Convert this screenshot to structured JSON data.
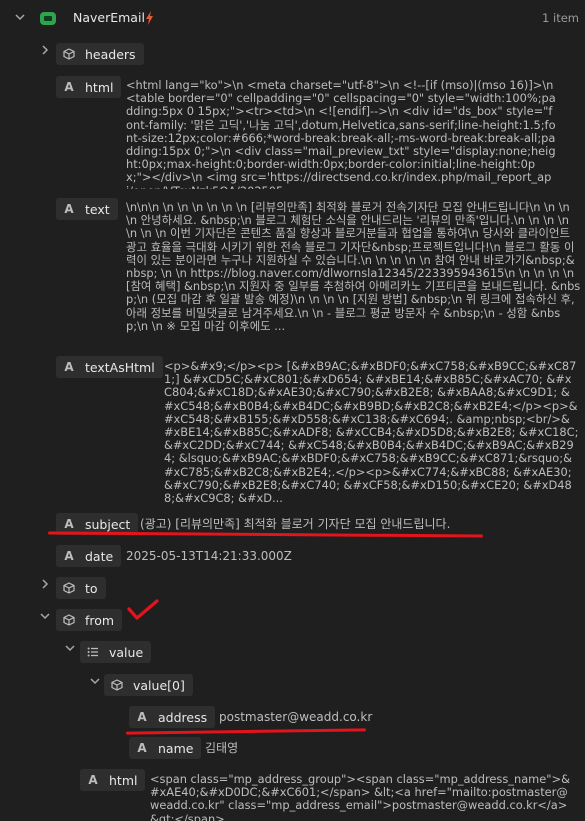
{
  "root": {
    "label": "NaverEmail",
    "count": "1 item",
    "accent": "#e05a3a"
  },
  "items": {
    "headers": "headers",
    "html": {
      "key": "html",
      "value": "<html lang=\"ko\">\\n <meta charset=\"utf-8\">\\n <!--[if (mso)|(mso 16)]>\\n <table border=\"0\" cellpadding=\"0\" cellspacing=\"0\" style=\"width:100%;padding:5px 0 15px;\"><tr><td>\\n <![endif]-->\\n <div id=\"ds_box\" style=\"font-family: '맑은 고딕','나눔 고딕',dotum,Helvetica,sans-serif;line-height:1.5;font-size:12px;color:#666;*word-break:break-all;-ms-word-break:break-all;padding:15px 0;\">\\n <div class=\"mail_preview_txt\" style=\"display:none;height:0px;max-height:0;border-width:0px;border-color:initial;line-height:0px;\"></div>\\n <img src='https://directsend.co.kr/index.php/mail_report_api/open/VTcxNzk5OA/202505..."
    },
    "text": {
      "key": "text",
      "value": "\\n\\n\\n \\n \\n \\n \\n \\n \\n [리뷰의만족] 최적화 블로거 전속기자단 모집 안내드립니다\\n \\n \\n \\n 안녕하세요. &nbsp;\\n 블로그 체험단 소식을 안내드리는 '리뷰의 만족'입니다.\\n \\n \\n \\n \\n \\n \\n 이번 기자단은 콘텐츠 품질 향상과 블로거분들과 협업을 통하여\\n 당사와 클라이언트 광고 효율을 극대화 시키기 위한 전속 블로그 기자단&nbsp;프로젝트입니다!\\n 블로그 활동 이력이 있는 분이라면 누구나 지원하실 수 있습니다.\\n \\n \\n \\n \\n 참여 안내 바로가기&nbsp;&nbsp; \\n \\n https://blog.naver.com/dlwornsla12345/223395943615\\n \\n \\n \\n \\n [참여 혜택] &nbsp;\\n 지원자 중 일부를 추첨하여 아메리카노 기프티콘을 보내드립니다. &nbsp;\\n (모집 마감 후 일괄 발송 예정)\\n \\n \\n \\n [지원 방법] &nbsp;\\n 위 링크에 접속하신 후, 아래 정보를 비밀댓글로 남겨주세요.\\n \\n - 블로그 평균 방문자 수 &nbsp;\\n - 성함 &nbsp;\\n \\n ※ 모집 마감 이후에도 ..."
    },
    "textAsHtml": {
      "key": "textAsHtml",
      "value": "<p>&#x9;</p><p> [&#xB9AC;&#xBDF0;&#xC758;&#xB9CC;&#xC871;] &#xCD5C;&#xC801;&#xD654; &#xBE14;&#xB85C;&#xAC70; &#xC804;&#xC18D;&#xAE30;&#xC790;&#xB2E8; &#xBAA8;&#xC9D1; &#xC548;&#xB0B4;&#xB4DC;&#xB9BD;&#xB2C8;&#xB2E4;</p><p>&#xC548;&#xB155;&#xD558;&#xC138;&#xC694;. &amp;nbsp;<br/>&#xBE14;&#xB85C;&#xADF8; &#xCCB4;&#xD5D8;&#xB2E8; &#xC18C;&#xC2DD;&#xC744; &#xC548;&#xB0B4;&#xB4DC;&#xB9AC;&#xB294; &lsquo;&#xB9AC;&#xBDF0;&#xC758;&#xB9CC;&#xC871;&rsquo;&#xC785;&#xB2C8;&#xB2E4;.</p><p>&#xC774;&#xBC88; &#xAE30;&#xC790;&#xB2E8;&#xC740; &#xCF58;&#xD150;&#xCE20; &#xD488;&#xC9C8; &#xD..."
    },
    "subject": {
      "key": "subject",
      "value": "(광고) [리뷰의만족] 최적화 블로거 기자단 모집 안내드립니다."
    },
    "date": {
      "key": "date",
      "value": "2025-05-13T14:21:33.000Z"
    },
    "to": "to",
    "from": "from",
    "from_value": "value",
    "from_value0": "value[0]",
    "address": {
      "key": "address",
      "value": "postmaster@weadd.co.kr"
    },
    "name": {
      "key": "name",
      "value": "김태영"
    },
    "from_html": {
      "key": "html",
      "value": "<span class=\"mp_address_group\"><span class=\"mp_address_name\">&#xAE40;&#xD0DC;&#xC601;</span> &lt;<a href=\"mailto:postmaster@weadd.co.kr\" class=\"mp_address_email\">postmaster@weadd.co.kr</a>&gt;</span>"
    }
  },
  "colors": {
    "background": "#1f1f1f",
    "pill": "#2e2e2e",
    "annotation_red": "#e3141b"
  }
}
